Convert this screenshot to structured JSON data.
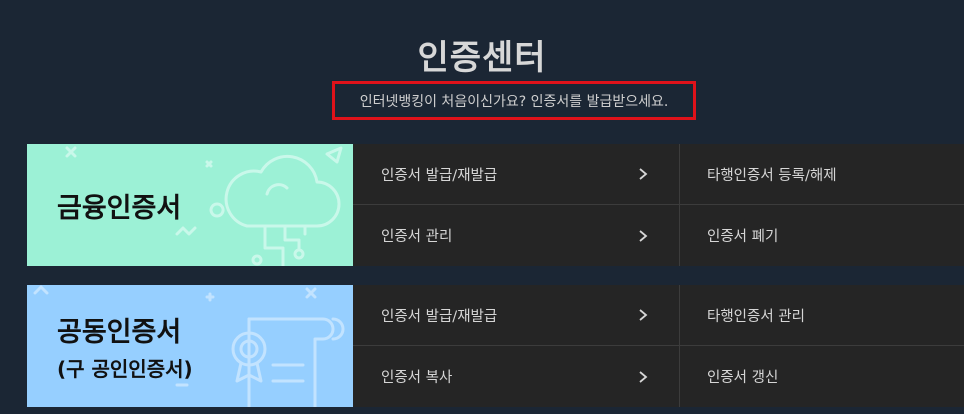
{
  "header": {
    "title": "인증센터",
    "subtitle": "인터넷뱅킹이 처음이신가요? 인증서를 발급받으세요."
  },
  "sections": [
    {
      "card_title": "금융인증서",
      "card_sub": "",
      "card_color": "#9cf1d6",
      "icon": "cloud-circuit-icon",
      "items": [
        {
          "label": "인증서 발급/재발급",
          "chevron": true
        },
        {
          "label": "타행인증서 등록/해제",
          "chevron": false
        },
        {
          "label": "인증서 관리",
          "chevron": true
        },
        {
          "label": "인증서 폐기",
          "chevron": false
        }
      ]
    },
    {
      "card_title": "공동인증서",
      "card_sub": "(구 공인인증서)",
      "card_color": "#96cfff",
      "icon": "certificate-scroll-icon",
      "items": [
        {
          "label": "인증서 발급/재발급",
          "chevron": true
        },
        {
          "label": "타행인증서 관리",
          "chevron": false
        },
        {
          "label": "인증서 복사",
          "chevron": true
        },
        {
          "label": "인증서 갱신",
          "chevron": false
        }
      ]
    }
  ]
}
